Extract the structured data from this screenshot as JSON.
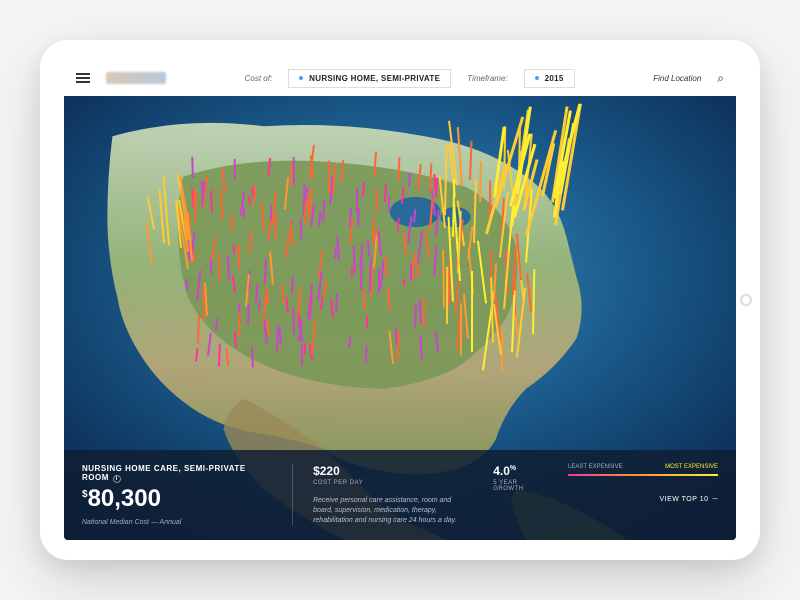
{
  "topbar": {
    "cost_of_label": "Cost of:",
    "cost_of_value": "NURSING HOME, SEMI-PRIVATE",
    "timeframe_label": "Timeframe:",
    "timeframe_value": "2015",
    "find_location": "Find Location"
  },
  "panel": {
    "title": "NURSING HOME CARE, SEMI-PRIVATE ROOM",
    "annual_cost": "80,300",
    "annual_sub": "National Median Cost — Annual",
    "cost_per_day": "$220",
    "cost_per_day_label": "COST PER DAY",
    "growth": "4.0",
    "growth_label": "5 YEAR GROWTH",
    "description": "Receive personal care assistance, room and board, supervision, medication, therapy, rehabilitation and nursing care 24 hours a day.",
    "legend_left": "LEAST EXPENSIVE",
    "legend_right": "MOST EXPENSIVE",
    "view_top": "VIEW TOP 10"
  },
  "legend_colors": {
    "low": "#ff3399",
    "mid": "#ff9933",
    "high": "#ffee33"
  }
}
